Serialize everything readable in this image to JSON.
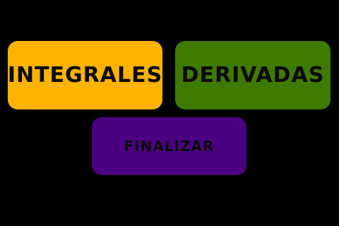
{
  "menu": {
    "buttons": [
      {
        "label": "INTEGRALES",
        "color": "#fdb300"
      },
      {
        "label": "DERIVADAS",
        "color": "#3f7a00"
      },
      {
        "label": "FINALIZAR",
        "color": "#4b0082"
      }
    ]
  },
  "colors": {
    "background": "#000000",
    "text": "#0a0a0a"
  }
}
